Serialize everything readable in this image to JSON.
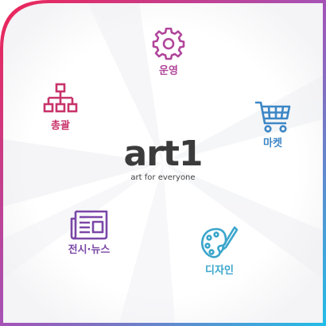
{
  "logo": {
    "name": "art1",
    "tagline": "art for everyone"
  },
  "menu": {
    "operations": {
      "label": "운영",
      "icon": "gear-icon",
      "color": "#b0459a"
    },
    "organization": {
      "label": "총괄",
      "icon": "org-chart-icon",
      "color": "#c8336a"
    },
    "market": {
      "label": "마켓",
      "icon": "shopping-cart-icon",
      "color": "#3d86c6"
    },
    "exhibition_news": {
      "label": "전시·뉴스",
      "icon": "newspaper-icon",
      "color": "#7a47a7"
    },
    "design": {
      "label": "디자인",
      "icon": "palette-brush-icon",
      "color": "#3aa6cb"
    }
  },
  "frame": {
    "gradient_start": "#e6245e",
    "gradient_mid": "#a550b8",
    "gradient_end": "#29b8e4"
  }
}
